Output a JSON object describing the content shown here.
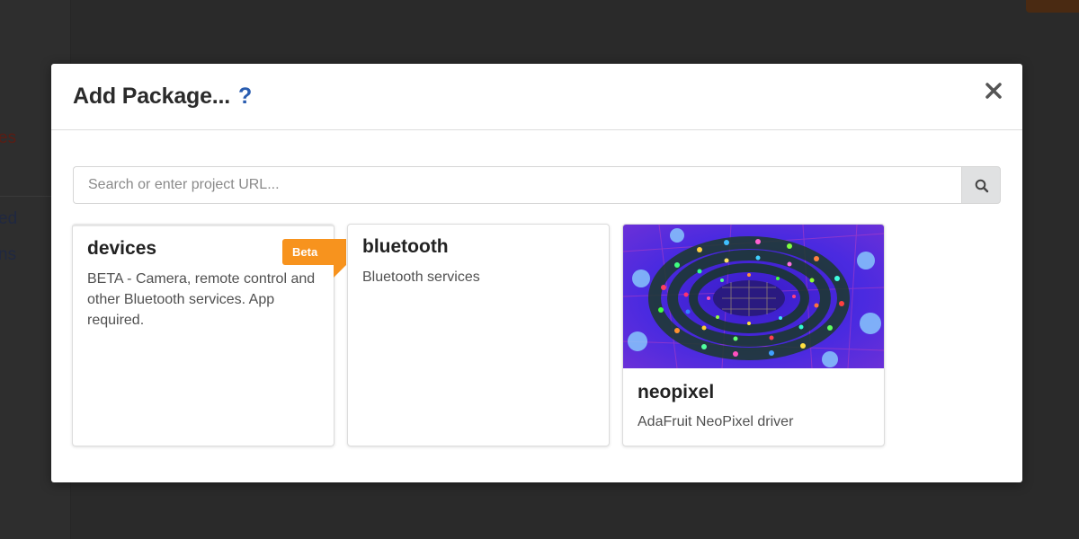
{
  "background": {
    "fragments": [
      "es",
      "ed",
      "ns"
    ]
  },
  "modal": {
    "title": "Add Package...",
    "help_label": "?",
    "close_label": "✕"
  },
  "search": {
    "placeholder": "Search or enter project URL...",
    "value": ""
  },
  "cards": [
    {
      "name": "devices",
      "description": "BETA - Camera, remote control and other Bluetooth services. App required.",
      "badge": "Beta",
      "badge_color": "#f7931e"
    },
    {
      "name": "bluetooth",
      "description": "Bluetooth services"
    },
    {
      "name": "neopixel",
      "description": "AdaFruit NeoPixel driver",
      "image": "neopixel-led-strip-photo"
    }
  ],
  "colors": {
    "help": "#2a5db0",
    "badge": "#f7931e",
    "search_button": "#e0e1e2"
  }
}
